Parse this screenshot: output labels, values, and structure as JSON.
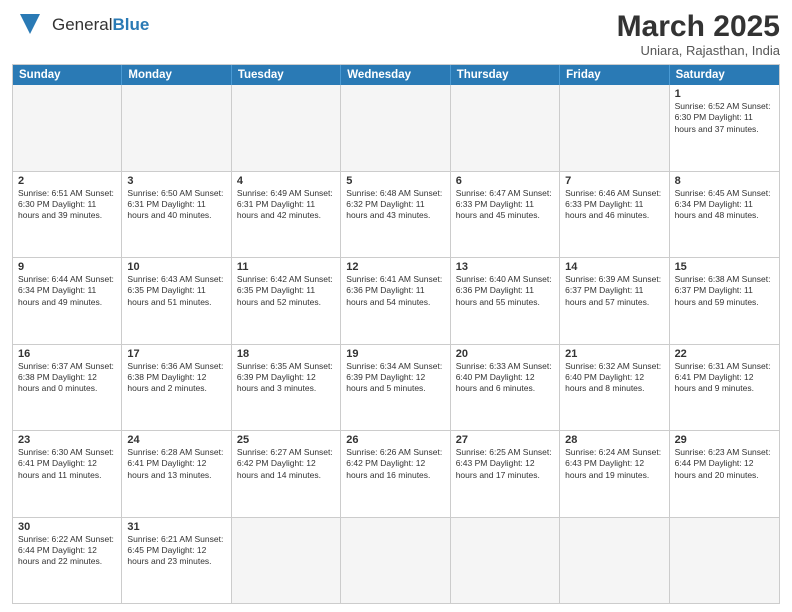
{
  "logo": {
    "text_general": "General",
    "text_blue": "Blue"
  },
  "title": "March 2025",
  "subtitle": "Uniara, Rajasthan, India",
  "header_days": [
    "Sunday",
    "Monday",
    "Tuesday",
    "Wednesday",
    "Thursday",
    "Friday",
    "Saturday"
  ],
  "weeks": [
    [
      {
        "day": "",
        "info": ""
      },
      {
        "day": "",
        "info": ""
      },
      {
        "day": "",
        "info": ""
      },
      {
        "day": "",
        "info": ""
      },
      {
        "day": "",
        "info": ""
      },
      {
        "day": "",
        "info": ""
      },
      {
        "day": "1",
        "info": "Sunrise: 6:52 AM\nSunset: 6:30 PM\nDaylight: 11 hours and 37 minutes."
      }
    ],
    [
      {
        "day": "2",
        "info": "Sunrise: 6:51 AM\nSunset: 6:30 PM\nDaylight: 11 hours and 39 minutes."
      },
      {
        "day": "3",
        "info": "Sunrise: 6:50 AM\nSunset: 6:31 PM\nDaylight: 11 hours and 40 minutes."
      },
      {
        "day": "4",
        "info": "Sunrise: 6:49 AM\nSunset: 6:31 PM\nDaylight: 11 hours and 42 minutes."
      },
      {
        "day": "5",
        "info": "Sunrise: 6:48 AM\nSunset: 6:32 PM\nDaylight: 11 hours and 43 minutes."
      },
      {
        "day": "6",
        "info": "Sunrise: 6:47 AM\nSunset: 6:33 PM\nDaylight: 11 hours and 45 minutes."
      },
      {
        "day": "7",
        "info": "Sunrise: 6:46 AM\nSunset: 6:33 PM\nDaylight: 11 hours and 46 minutes."
      },
      {
        "day": "8",
        "info": "Sunrise: 6:45 AM\nSunset: 6:34 PM\nDaylight: 11 hours and 48 minutes."
      }
    ],
    [
      {
        "day": "9",
        "info": "Sunrise: 6:44 AM\nSunset: 6:34 PM\nDaylight: 11 hours and 49 minutes."
      },
      {
        "day": "10",
        "info": "Sunrise: 6:43 AM\nSunset: 6:35 PM\nDaylight: 11 hours and 51 minutes."
      },
      {
        "day": "11",
        "info": "Sunrise: 6:42 AM\nSunset: 6:35 PM\nDaylight: 11 hours and 52 minutes."
      },
      {
        "day": "12",
        "info": "Sunrise: 6:41 AM\nSunset: 6:36 PM\nDaylight: 11 hours and 54 minutes."
      },
      {
        "day": "13",
        "info": "Sunrise: 6:40 AM\nSunset: 6:36 PM\nDaylight: 11 hours and 55 minutes."
      },
      {
        "day": "14",
        "info": "Sunrise: 6:39 AM\nSunset: 6:37 PM\nDaylight: 11 hours and 57 minutes."
      },
      {
        "day": "15",
        "info": "Sunrise: 6:38 AM\nSunset: 6:37 PM\nDaylight: 11 hours and 59 minutes."
      }
    ],
    [
      {
        "day": "16",
        "info": "Sunrise: 6:37 AM\nSunset: 6:38 PM\nDaylight: 12 hours and 0 minutes."
      },
      {
        "day": "17",
        "info": "Sunrise: 6:36 AM\nSunset: 6:38 PM\nDaylight: 12 hours and 2 minutes."
      },
      {
        "day": "18",
        "info": "Sunrise: 6:35 AM\nSunset: 6:39 PM\nDaylight: 12 hours and 3 minutes."
      },
      {
        "day": "19",
        "info": "Sunrise: 6:34 AM\nSunset: 6:39 PM\nDaylight: 12 hours and 5 minutes."
      },
      {
        "day": "20",
        "info": "Sunrise: 6:33 AM\nSunset: 6:40 PM\nDaylight: 12 hours and 6 minutes."
      },
      {
        "day": "21",
        "info": "Sunrise: 6:32 AM\nSunset: 6:40 PM\nDaylight: 12 hours and 8 minutes."
      },
      {
        "day": "22",
        "info": "Sunrise: 6:31 AM\nSunset: 6:41 PM\nDaylight: 12 hours and 9 minutes."
      }
    ],
    [
      {
        "day": "23",
        "info": "Sunrise: 6:30 AM\nSunset: 6:41 PM\nDaylight: 12 hours and 11 minutes."
      },
      {
        "day": "24",
        "info": "Sunrise: 6:28 AM\nSunset: 6:41 PM\nDaylight: 12 hours and 13 minutes."
      },
      {
        "day": "25",
        "info": "Sunrise: 6:27 AM\nSunset: 6:42 PM\nDaylight: 12 hours and 14 minutes."
      },
      {
        "day": "26",
        "info": "Sunrise: 6:26 AM\nSunset: 6:42 PM\nDaylight: 12 hours and 16 minutes."
      },
      {
        "day": "27",
        "info": "Sunrise: 6:25 AM\nSunset: 6:43 PM\nDaylight: 12 hours and 17 minutes."
      },
      {
        "day": "28",
        "info": "Sunrise: 6:24 AM\nSunset: 6:43 PM\nDaylight: 12 hours and 19 minutes."
      },
      {
        "day": "29",
        "info": "Sunrise: 6:23 AM\nSunset: 6:44 PM\nDaylight: 12 hours and 20 minutes."
      }
    ],
    [
      {
        "day": "30",
        "info": "Sunrise: 6:22 AM\nSunset: 6:44 PM\nDaylight: 12 hours and 22 minutes."
      },
      {
        "day": "31",
        "info": "Sunrise: 6:21 AM\nSunset: 6:45 PM\nDaylight: 12 hours and 23 minutes."
      },
      {
        "day": "",
        "info": ""
      },
      {
        "day": "",
        "info": ""
      },
      {
        "day": "",
        "info": ""
      },
      {
        "day": "",
        "info": ""
      },
      {
        "day": "",
        "info": ""
      }
    ]
  ]
}
